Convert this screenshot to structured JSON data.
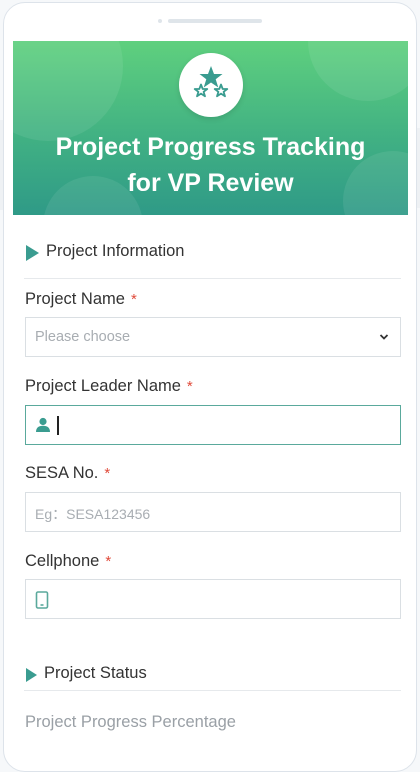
{
  "header": {
    "title_line1": "Project Progress Tracking",
    "title_line2": "for VP Review",
    "logo_icon": "stars-icon",
    "gradient_colors": [
      "#5fd07e",
      "#2f9a87"
    ]
  },
  "sections": {
    "project_information": "Project Information",
    "project_status": "Project Status"
  },
  "fields": {
    "project_name": {
      "label": "Project Name",
      "required_mark": "*",
      "placeholder": "Please choose",
      "type": "select"
    },
    "project_leader_name": {
      "label": "Project Leader Name",
      "required_mark": "*",
      "value": "",
      "icon": "user-icon",
      "focused": true
    },
    "sesa_no": {
      "label": "SESA No.",
      "required_mark": "*",
      "placeholder": "Eg：SESA123456"
    },
    "cellphone": {
      "label": "Cellphone",
      "required_mark": "*",
      "value": "",
      "icon": "phone-icon"
    },
    "project_progress_percentage": {
      "label": "Project Progress Percentage"
    }
  },
  "colors": {
    "accent": "#3a9c90",
    "required": "#e04a3a"
  }
}
